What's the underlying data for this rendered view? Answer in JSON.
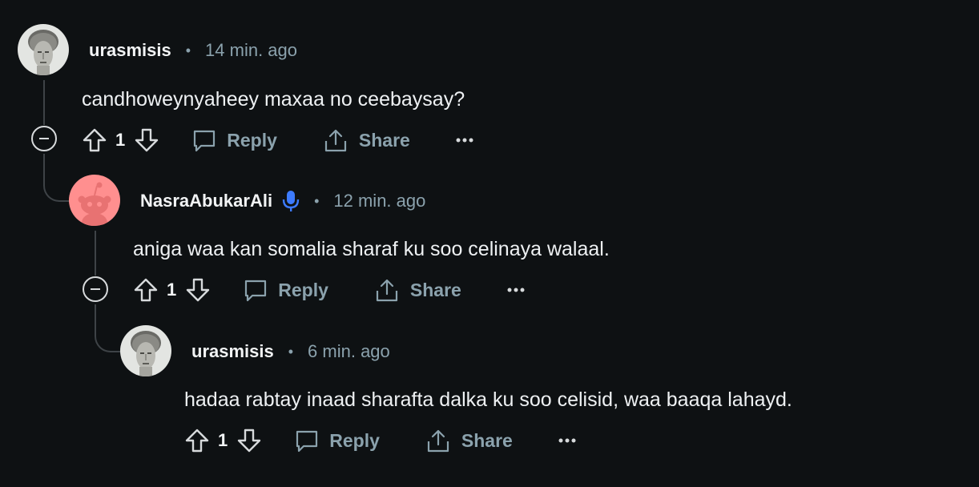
{
  "comments": [
    {
      "username": "urasmisis",
      "time": "14 min. ago",
      "body": "candhoweynyaheey maxaa no ceebaysay?",
      "score": "1",
      "reply_label": "Reply",
      "share_label": "Share",
      "avatar_icon": "statue-face-avatar"
    },
    {
      "username": "NasraAbukarAli",
      "time": "12 min. ago",
      "body": "aniga waa kan somalia sharaf ku soo celinaya walaal.",
      "score": "1",
      "reply_label": "Reply",
      "share_label": "Share",
      "avatar_icon": "snoo-avatar",
      "badge_icon": "microphone-icon"
    },
    {
      "username": "urasmisis",
      "time": "6 min. ago",
      "body": "hadaa rabtay inaad sharafta dalka ku soo celisid, waa baaqa lahayd.",
      "score": "1",
      "reply_label": "Reply",
      "share_label": "Share",
      "avatar_icon": "statue-face-avatar"
    }
  ],
  "meta_separator": "•",
  "colors": {
    "background": "#0e1113",
    "muted": "#8ba2ad",
    "thread_line": "#3e4347",
    "snoo_bg": "#ff8f8f",
    "mic_blue": "#3d7bff"
  }
}
